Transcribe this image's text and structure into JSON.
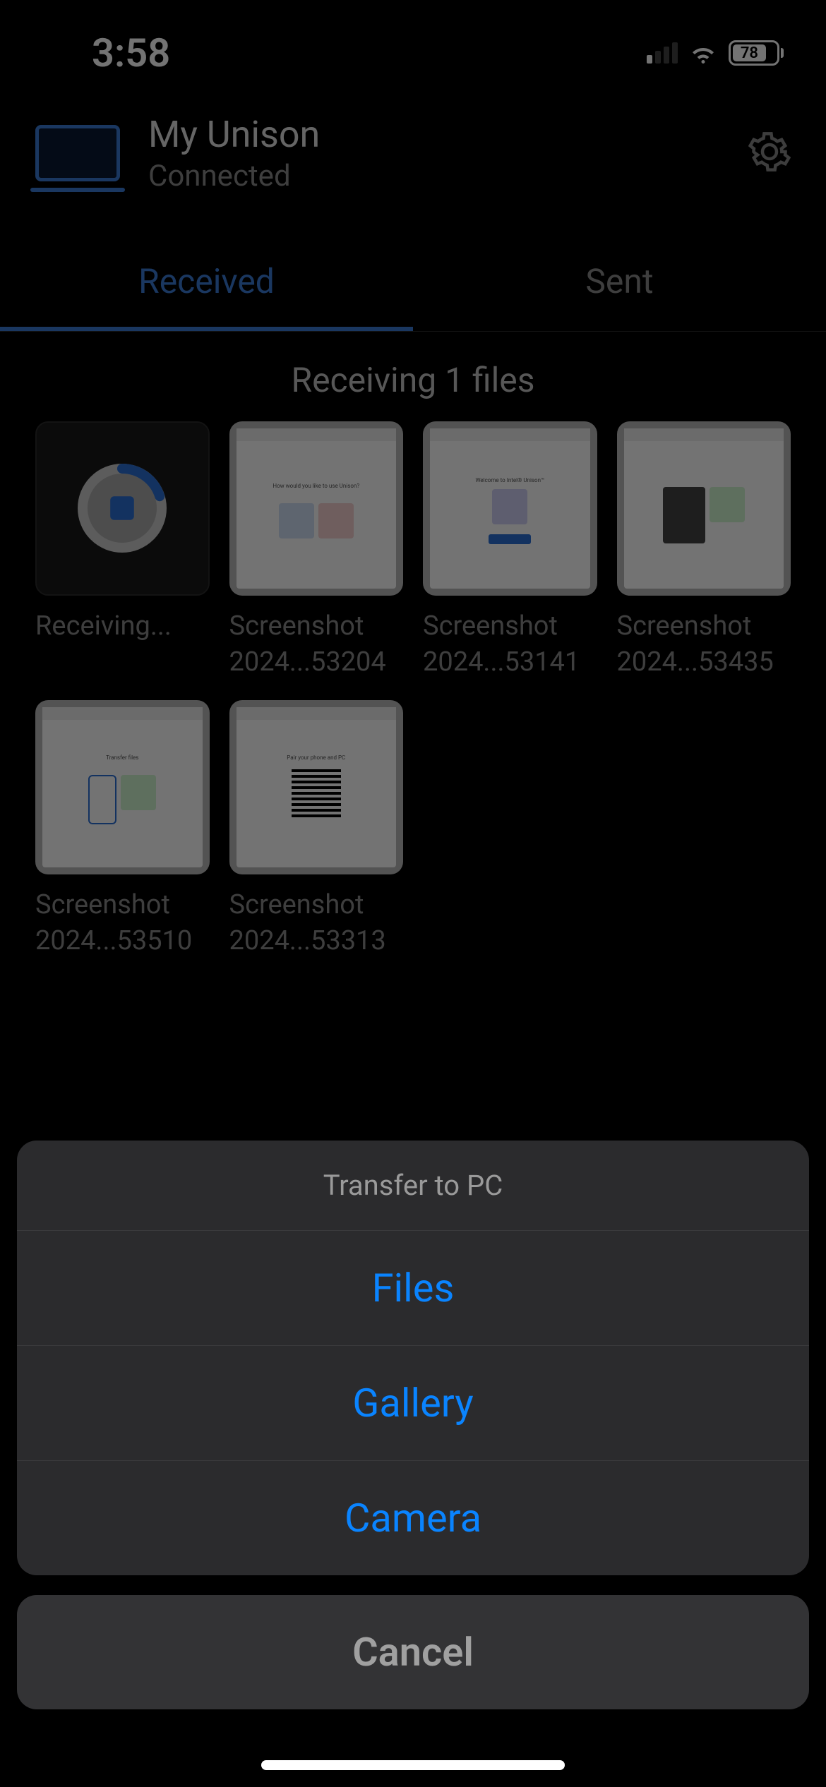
{
  "status": {
    "time": "3:58",
    "battery": "78"
  },
  "header": {
    "title": "My Unison",
    "status": "Connected"
  },
  "tabs": {
    "received": "Received",
    "sent": "Sent"
  },
  "receiving_title": "Receiving 1 files",
  "items": [
    {
      "label": "Receiving..."
    },
    {
      "label": "Screenshot 2024...53204"
    },
    {
      "label": "Screenshot 2024...53141"
    },
    {
      "label": "Screenshot 2024...53435"
    },
    {
      "label": "Screenshot 2024...53510"
    },
    {
      "label": "Screenshot 2024...53313"
    }
  ],
  "sheet": {
    "title": "Transfer to PC",
    "files": "Files",
    "gallery": "Gallery",
    "camera": "Camera",
    "cancel": "Cancel"
  }
}
